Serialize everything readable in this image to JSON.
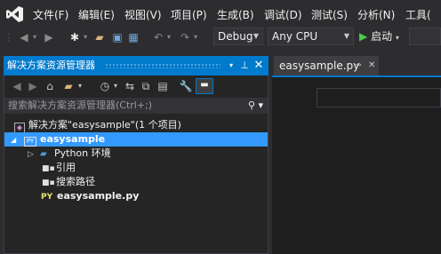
{
  "menu": [
    "文件(F)",
    "编辑(E)",
    "视图(V)",
    "项目(P)",
    "生成(B)",
    "调试(D)",
    "测试(S)",
    "分析(N)",
    "工具("
  ],
  "toolbar": {
    "config": "Debug",
    "platform": "Any CPU",
    "start_label": "启动"
  },
  "solution_explorer": {
    "title": "解决方案资源管理器",
    "search_placeholder": "搜索解决方案资源管理器(Ctrl+;)",
    "solution_label": "解决方案\"easysample\"(1 个项目)",
    "project_label": "easysample",
    "items": [
      {
        "label": "Python 环境",
        "icon": "expand-arrow-icon"
      },
      {
        "label": "引用",
        "icon": "reference-icon"
      },
      {
        "label": "搜索路径",
        "icon": "search-path-icon"
      },
      {
        "label": "easysample.py",
        "icon": "python-file-icon"
      }
    ]
  },
  "editor": {
    "tab_label": "easysample.py"
  },
  "colors": {
    "accent": "#007acc",
    "selection": "#3399ff",
    "background": "#2d2d30",
    "editor_bg": "#1e1e1e"
  }
}
